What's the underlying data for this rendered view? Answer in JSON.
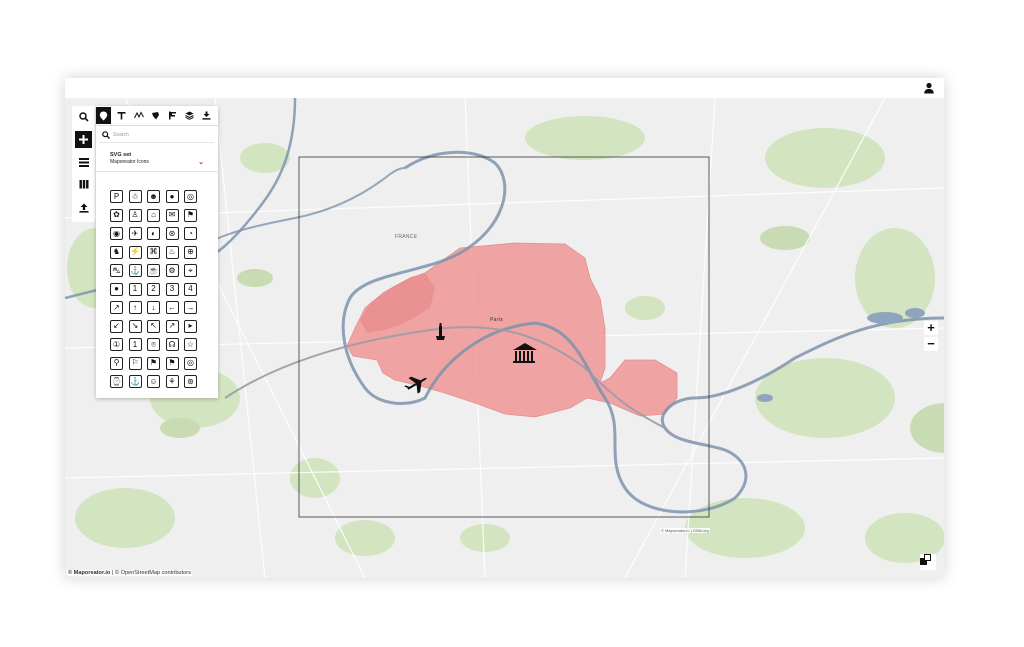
{
  "app": {
    "attribution_brand": "© Maporeator.io",
    "attribution_rest": " | © OpenStreetMap contributors",
    "inner_attribution": "© Maporeator.io | OSM.org"
  },
  "panel": {
    "search_placeholder": "Search",
    "set_title": "SVG set",
    "set_value": "Maporeator Icons",
    "tabs": [
      "marker-icon",
      "text-icon",
      "line-icon",
      "area-icon",
      "flag-icon",
      "layers-icon",
      "download-icon"
    ]
  },
  "map": {
    "label_country": "FRANCE",
    "label_city": "Paris",
    "zoom_in": "+",
    "zoom_out": "−",
    "colors": {
      "highlight": "#f08a8a",
      "river": "#7d93ad",
      "park": "#cfe2bb",
      "land": "#efefef"
    }
  },
  "icon_grid": {
    "rows": [
      [
        "P",
        "☃",
        "☻",
        "●",
        "◎"
      ],
      [
        "✿",
        "♙",
        "⌂",
        "✉",
        "⚑"
      ],
      [
        "◉",
        "✈",
        "◐",
        "⊛",
        "◔"
      ],
      [
        "♞",
        "⚡",
        "⌘",
        "♨",
        "⊕"
      ],
      [
        "⛍",
        "⚓",
        "☕",
        "⚙",
        "⌖"
      ],
      [
        "●",
        "1",
        "2",
        "3",
        "4"
      ],
      [
        "↗",
        "↑",
        "↓",
        "←",
        "→"
      ],
      [
        "↙",
        "↘",
        "↖",
        "↗",
        "▸"
      ],
      [
        "①",
        "1",
        "⌾",
        "☊",
        "☆"
      ],
      [
        "⚲",
        "⚐",
        "⚑",
        "⚑",
        "◎"
      ],
      [
        "⌚",
        "⚓",
        "☺",
        "⚘",
        "⊛"
      ]
    ]
  }
}
